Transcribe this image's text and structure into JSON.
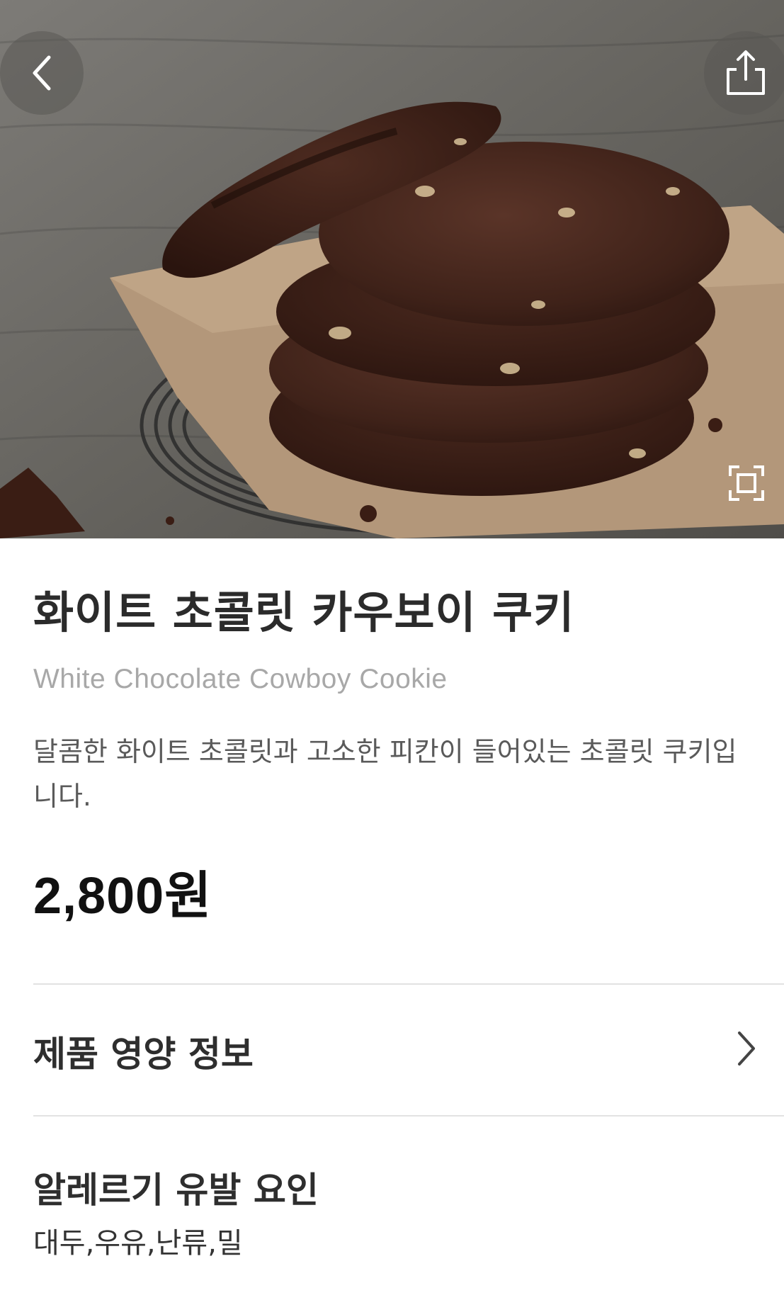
{
  "header": {
    "back_icon": "chevron-left-icon",
    "share_icon": "share-icon",
    "expand_icon": "expand-frame-icon"
  },
  "product": {
    "name_ko": "화이트 초콜릿 카우보이 쿠키",
    "name_en": "White Chocolate Cowboy Cookie",
    "description": "달콤한 화이트 초콜릿과 고소한 피칸이 들어있는 초콜릿 쿠키입니다.",
    "price": "2,800원"
  },
  "nutrition": {
    "label": "제품 영양 정보",
    "icon": "chevron-right-icon"
  },
  "allergy": {
    "title": "알레르기 유발 요인",
    "value": "대두,우유,난류,밀"
  },
  "colors": {
    "title": "#2b2b2b",
    "subtitle": "#a8a8a8",
    "description": "#5a5a5a",
    "price": "#111111",
    "divider": "#e2e2e2"
  }
}
